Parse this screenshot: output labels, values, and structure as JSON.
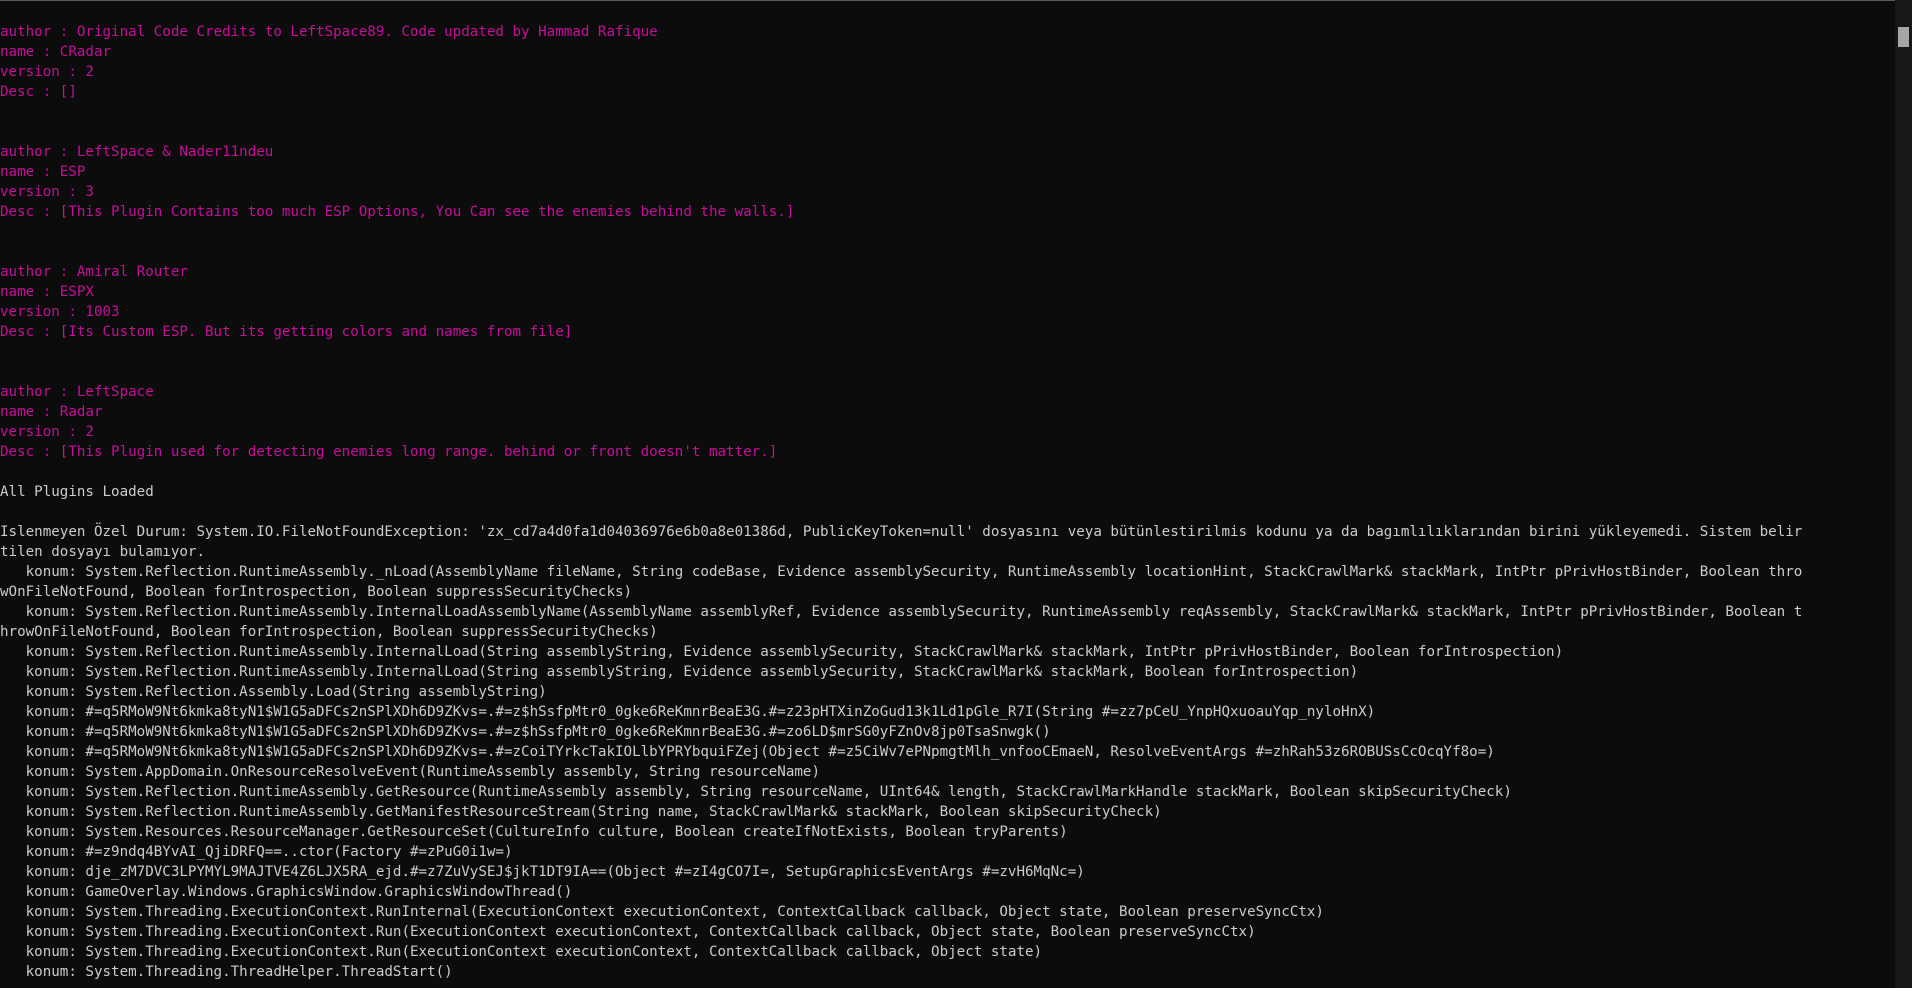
{
  "colors": {
    "background": "#0c0c0c",
    "plugin_text": "#c50f9a",
    "default_text": "#cccccc"
  },
  "lines": [
    {
      "text": "author : Original Code Credits to LeftSpace89. Code updated by Hammad Rafique",
      "color": "magenta"
    },
    {
      "text": "name : CRadar",
      "color": "magenta"
    },
    {
      "text": "version : 2",
      "color": "magenta"
    },
    {
      "text": "Desc : []",
      "color": "magenta"
    },
    {
      "text": "",
      "color": "white"
    },
    {
      "text": "",
      "color": "white"
    },
    {
      "text": "author : LeftSpace & Nader11ndeu",
      "color": "magenta"
    },
    {
      "text": "name : ESP",
      "color": "magenta"
    },
    {
      "text": "version : 3",
      "color": "magenta"
    },
    {
      "text": "Desc : [This Plugin Contains too much ESP Options, You Can see the enemies behind the walls.]",
      "color": "magenta"
    },
    {
      "text": "",
      "color": "white"
    },
    {
      "text": "",
      "color": "white"
    },
    {
      "text": "author : Amiral Router",
      "color": "magenta"
    },
    {
      "text": "name : ESPX",
      "color": "magenta"
    },
    {
      "text": "version : 1003",
      "color": "magenta"
    },
    {
      "text": "Desc : [Its Custom ESP. But its getting colors and names from file]",
      "color": "magenta"
    },
    {
      "text": "",
      "color": "white"
    },
    {
      "text": "",
      "color": "white"
    },
    {
      "text": "author : LeftSpace",
      "color": "magenta"
    },
    {
      "text": "name : Radar",
      "color": "magenta"
    },
    {
      "text": "version : 2",
      "color": "magenta"
    },
    {
      "text": "Desc : [This Plugin used for detecting enemies long range. behind or front doesn't matter.]",
      "color": "magenta"
    },
    {
      "text": "",
      "color": "white"
    },
    {
      "text": "All Plugins Loaded",
      "color": "white"
    },
    {
      "text": "",
      "color": "white"
    },
    {
      "text": "Islenmeyen Özel Durum: System.IO.FileNotFoundException: 'zx_cd7a4d0fa1d04036976e6b0a8e01386d, PublicKeyToken=null' dosyasını veya bütünlestirilmis kodunu ya da bagımlılıklarından birini yükleyemedi. Sistem belir",
      "color": "white"
    },
    {
      "text": "tilen dosyayı bulamıyor.",
      "color": "white"
    },
    {
      "text": "   konum: System.Reflection.RuntimeAssembly._nLoad(AssemblyName fileName, String codeBase, Evidence assemblySecurity, RuntimeAssembly locationHint, StackCrawlMark& stackMark, IntPtr pPrivHostBinder, Boolean thro",
      "color": "white"
    },
    {
      "text": "wOnFileNotFound, Boolean forIntrospection, Boolean suppressSecurityChecks)",
      "color": "white"
    },
    {
      "text": "   konum: System.Reflection.RuntimeAssembly.InternalLoadAssemblyName(AssemblyName assemblyRef, Evidence assemblySecurity, RuntimeAssembly reqAssembly, StackCrawlMark& stackMark, IntPtr pPrivHostBinder, Boolean t",
      "color": "white"
    },
    {
      "text": "hrowOnFileNotFound, Boolean forIntrospection, Boolean suppressSecurityChecks)",
      "color": "white"
    },
    {
      "text": "   konum: System.Reflection.RuntimeAssembly.InternalLoad(String assemblyString, Evidence assemblySecurity, StackCrawlMark& stackMark, IntPtr pPrivHostBinder, Boolean forIntrospection)",
      "color": "white"
    },
    {
      "text": "   konum: System.Reflection.RuntimeAssembly.InternalLoad(String assemblyString, Evidence assemblySecurity, StackCrawlMark& stackMark, Boolean forIntrospection)",
      "color": "white"
    },
    {
      "text": "   konum: System.Reflection.Assembly.Load(String assemblyString)",
      "color": "white"
    },
    {
      "text": "   konum: #=q5RMoW9Nt6kmka8tyN1$W1G5aDFCs2nSPlXDh6D9ZKvs=.#=z$hSsfpMtr0_0gke6ReKmnrBeaE3G.#=z23pHTXinZoGud13k1Ld1pGle_R7I(String #=zz7pCeU_YnpHQxuoauYqp_nyloHnX)",
      "color": "white"
    },
    {
      "text": "   konum: #=q5RMoW9Nt6kmka8tyN1$W1G5aDFCs2nSPlXDh6D9ZKvs=.#=z$hSsfpMtr0_0gke6ReKmnrBeaE3G.#=zo6LD$mrSG0yFZnOv8jp0TsaSnwgk()",
      "color": "white"
    },
    {
      "text": "   konum: #=q5RMoW9Nt6kmka8tyN1$W1G5aDFCs2nSPlXDh6D9ZKvs=.#=zCoiTYrkcTakIOLlbYPRYbquiFZej(Object #=z5CiWv7ePNpmgtMlh_vnfooCEmaeN, ResolveEventArgs #=zhRah53z6ROBUSsCcOcqYf8o=)",
      "color": "white"
    },
    {
      "text": "   konum: System.AppDomain.OnResourceResolveEvent(RuntimeAssembly assembly, String resourceName)",
      "color": "white"
    },
    {
      "text": "   konum: System.Reflection.RuntimeAssembly.GetResource(RuntimeAssembly assembly, String resourceName, UInt64& length, StackCrawlMarkHandle stackMark, Boolean skipSecurityCheck)",
      "color": "white"
    },
    {
      "text": "   konum: System.Reflection.RuntimeAssembly.GetManifestResourceStream(String name, StackCrawlMark& stackMark, Boolean skipSecurityCheck)",
      "color": "white"
    },
    {
      "text": "   konum: System.Resources.ResourceManager.GetResourceSet(CultureInfo culture, Boolean createIfNotExists, Boolean tryParents)",
      "color": "white"
    },
    {
      "text": "   konum: #=z9ndq4BYvAI_QjiDRFQ==..ctor(Factory #=zPuG0i1w=)",
      "color": "white"
    },
    {
      "text": "   konum: dje_zM7DVC3LPYMYL9MAJTVE4Z6LJX5RA_ejd.#=z7ZuVySEJ$jkT1DT9IA==(Object #=zI4gCO7I=, SetupGraphicsEventArgs #=zvH6MqNc=)",
      "color": "white"
    },
    {
      "text": "   konum: GameOverlay.Windows.GraphicsWindow.GraphicsWindowThread()",
      "color": "white"
    },
    {
      "text": "   konum: System.Threading.ExecutionContext.RunInternal(ExecutionContext executionContext, ContextCallback callback, Object state, Boolean preserveSyncCtx)",
      "color": "white"
    },
    {
      "text": "   konum: System.Threading.ExecutionContext.Run(ExecutionContext executionContext, ContextCallback callback, Object state, Boolean preserveSyncCtx)",
      "color": "white"
    },
    {
      "text": "   konum: System.Threading.ExecutionContext.Run(ExecutionContext executionContext, ContextCallback callback, Object state)",
      "color": "white"
    },
    {
      "text": "   konum: System.Threading.ThreadHelper.ThreadStart()",
      "color": "white"
    }
  ]
}
